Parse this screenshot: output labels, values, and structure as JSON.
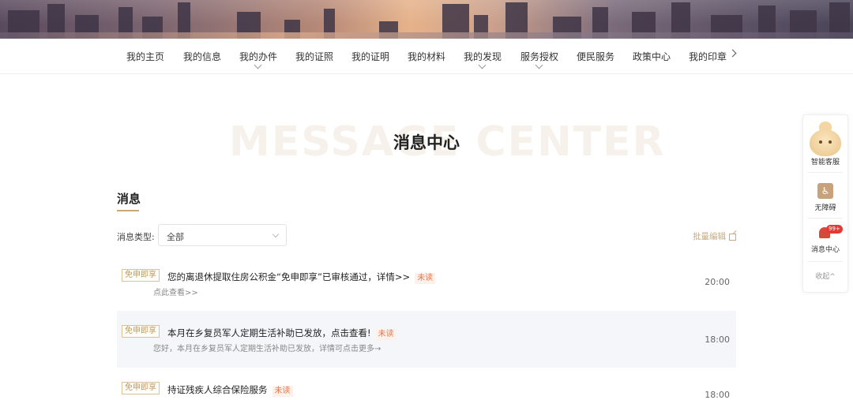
{
  "nav": {
    "items": [
      {
        "label": "我的主页"
      },
      {
        "label": "我的信息"
      },
      {
        "label": "我的办件"
      },
      {
        "label": "我的证照"
      },
      {
        "label": "我的证明"
      },
      {
        "label": "我的材料"
      },
      {
        "label": "我的发现"
      },
      {
        "label": "服务授权"
      },
      {
        "label": "便民服务"
      },
      {
        "label": "政策中心"
      },
      {
        "label": "我的印章"
      }
    ]
  },
  "page": {
    "watermark": "MESSAGE CENTER",
    "title": "消息中心"
  },
  "section": {
    "title": "消息",
    "filter_label": "消息类型:",
    "filter_value": "全部",
    "batch_edit": "批量编辑"
  },
  "messages": [
    {
      "tag": "免申即享",
      "title": "您的离退休提取住房公积金“免申即享”已审核通过，详情>>",
      "status": "未读",
      "subtitle": "点此查看>>",
      "time": "20:00"
    },
    {
      "tag": "免申即享",
      "title": "本月在乡复员军人定期生活补助已发放，点击查看!",
      "status": "未读",
      "subtitle": "您好，本月在乡复员军人定期生活补助已发放，详情可点击更多→",
      "time": "18:00"
    },
    {
      "tag": "免申即享",
      "title": "持证残疾人综合保险服务",
      "status": "未读",
      "subtitle": "",
      "time": "18:00"
    }
  ],
  "float_panel": {
    "assistant_label": "智能客服",
    "accessibility_label": "无障碍",
    "message_label": "消息中心",
    "badge": "99+",
    "collapse_label": "收起^"
  }
}
